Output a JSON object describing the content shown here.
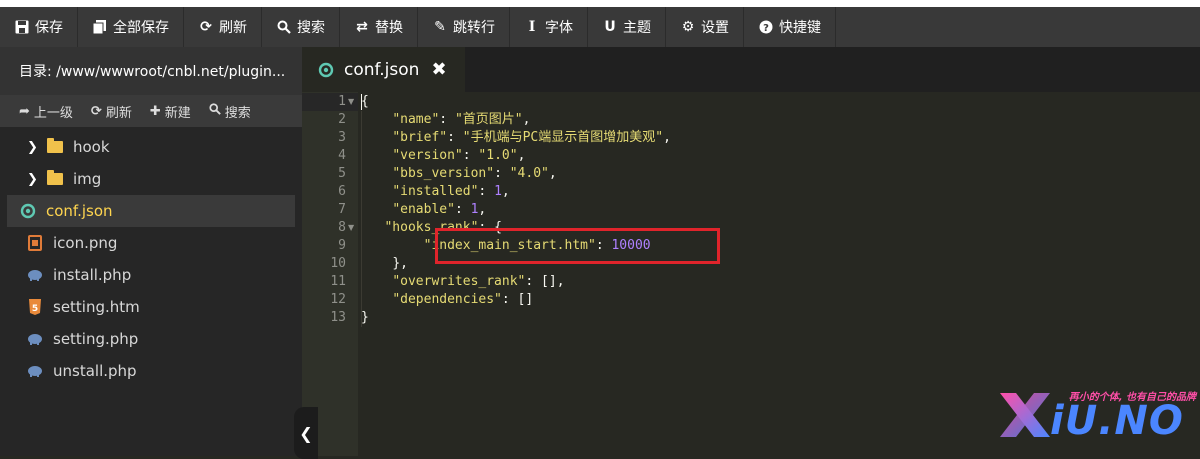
{
  "toolbar": {
    "buttons": [
      {
        "label": "保存",
        "icon": "save-icon"
      },
      {
        "label": "全部保存",
        "icon": "save-all-icon"
      },
      {
        "label": "刷新",
        "icon": "refresh-icon"
      },
      {
        "label": "搜索",
        "icon": "search-icon"
      },
      {
        "label": "替换",
        "icon": "replace-icon"
      },
      {
        "label": "跳转行",
        "icon": "goto-line-icon"
      },
      {
        "label": "字体",
        "icon": "font-icon"
      },
      {
        "label": "主题",
        "icon": "theme-icon"
      },
      {
        "label": "设置",
        "icon": "gear-icon"
      },
      {
        "label": "快捷键",
        "icon": "help-icon"
      }
    ]
  },
  "sidebar": {
    "directory": "目录: /www/wwwroot/cnbl.net/plugin...",
    "tools": [
      {
        "label": "上一级",
        "icon": "up-arrow-icon"
      },
      {
        "label": "刷新",
        "icon": "refresh-icon"
      },
      {
        "label": "新建",
        "icon": "plus-icon"
      },
      {
        "label": "搜索",
        "icon": "search-icon"
      }
    ],
    "tree": [
      {
        "label": "hook",
        "type": "folder"
      },
      {
        "label": "img",
        "type": "folder"
      },
      {
        "label": "conf.json",
        "type": "json",
        "active": true
      },
      {
        "label": "icon.png",
        "type": "image"
      },
      {
        "label": "install.php",
        "type": "php"
      },
      {
        "label": "setting.htm",
        "type": "html"
      },
      {
        "label": "setting.php",
        "type": "php"
      },
      {
        "label": "unstall.php",
        "type": "php"
      }
    ]
  },
  "editor": {
    "tab": {
      "label": "conf.json",
      "close": "✖"
    },
    "line_numbers": [
      "1",
      "2",
      "3",
      "4",
      "5",
      "6",
      "7",
      "8",
      "9",
      "10",
      "11",
      "12",
      "13"
    ],
    "lines": [
      "{",
      "    \"name\": \"首页图片\",",
      "    \"brief\": \"手机端与PC端显示首图增加美观\",",
      "    \"version\": \"1.0\",",
      "    \"bbs_version\": \"4.0\",",
      "    \"installed\": 1,",
      "    \"enable\": 1,",
      "   \"hooks_rank\": {",
      "        \"index_main_start.htm\": 10000",
      "    },",
      "    \"overwrites_rank\": [],",
      "    \"dependencies\": []",
      "}"
    ]
  },
  "watermark": {
    "tagline": "再小的个体, 也有自己的品牌",
    "logo": "XiU.NO"
  },
  "colors": {
    "accent_red": "#e0242b",
    "string": "#e6db74",
    "number": "#ae81ff"
  }
}
